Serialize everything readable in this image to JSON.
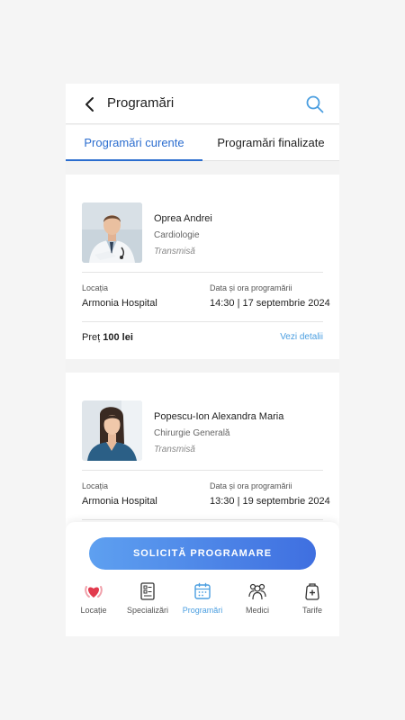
{
  "header": {
    "title": "Programări"
  },
  "tabs": [
    {
      "label": "Programări curente",
      "active": true
    },
    {
      "label": "Programări finalizate",
      "active": false
    }
  ],
  "appointments": [
    {
      "doctor": "Oprea Andrei",
      "specialty": "Cardiologie",
      "status": "Transmisă",
      "location_label": "Locația",
      "location": "Armonia Hospital",
      "datetime_label": "Data și ora programării",
      "datetime": "14:30 | 17 septembrie 2024",
      "price_prefix": "Preț",
      "price": "100 lei",
      "details_link": "Vezi detalii"
    },
    {
      "doctor": "Popescu-Ion Alexandra Maria",
      "specialty": "Chirurgie Generală",
      "status": "Transmisă",
      "location_label": "Locația",
      "location": "Armonia Hospital",
      "datetime_label": "Data și ora programării",
      "datetime": "13:30 | 19 septembrie 2024"
    }
  ],
  "cta": {
    "label": "SOLICITĂ PROGRAMARE"
  },
  "bottom_nav": [
    {
      "label": "Locație",
      "icon": "heart-location-icon",
      "active": false
    },
    {
      "label": "Specializări",
      "icon": "clipboard-icon",
      "active": false
    },
    {
      "label": "Programări",
      "icon": "calendar-icon",
      "active": true
    },
    {
      "label": "Medici",
      "icon": "doctors-icon",
      "active": false
    },
    {
      "label": "Tarife",
      "icon": "medical-bag-icon",
      "active": false
    }
  ],
  "colors": {
    "accent": "#2b6dcf",
    "link": "#4a9ee0",
    "cta_start": "#5ea0f0",
    "cta_end": "#3f6fe0",
    "heart": "#e23b4e"
  }
}
